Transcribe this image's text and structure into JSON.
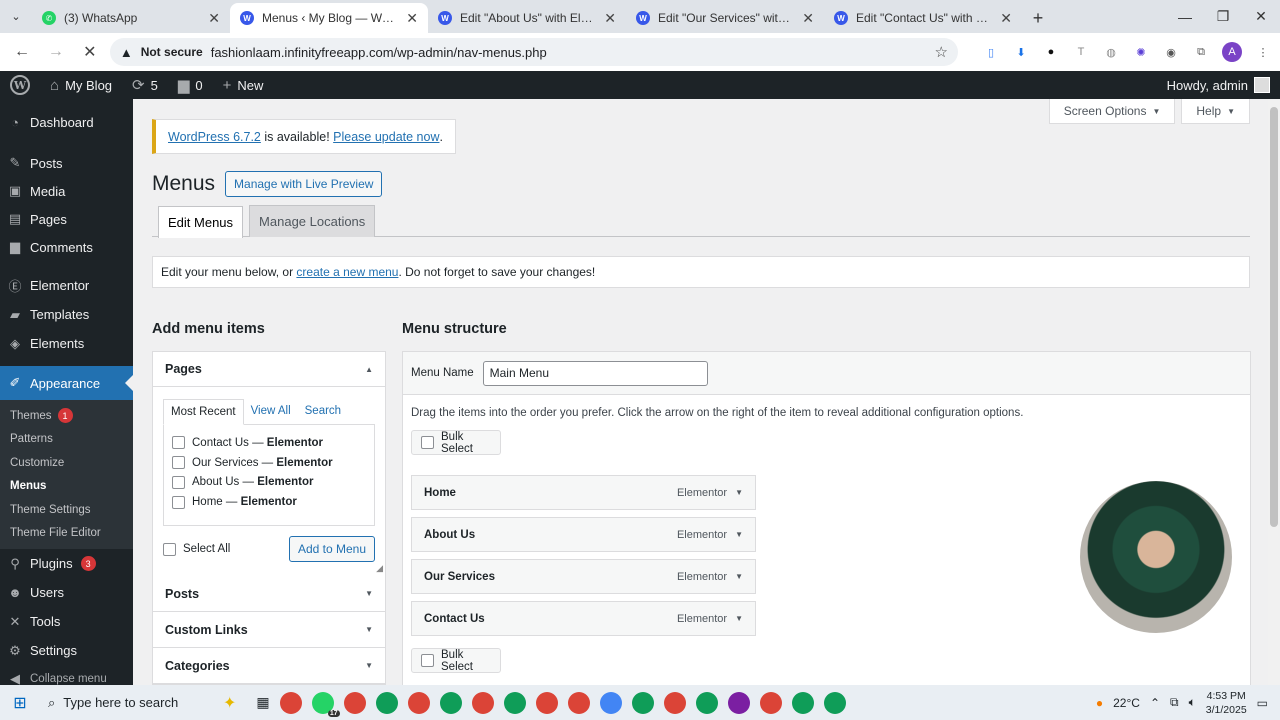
{
  "browser": {
    "tabs": [
      {
        "title": "(3) WhatsApp",
        "icon": "whatsapp-icon",
        "active": false
      },
      {
        "title": "Menus ‹ My Blog — WordPress",
        "icon": "wordpress-icon",
        "active": true
      },
      {
        "title": "Edit \"About Us\" with Elementor",
        "icon": "wordpress-icon",
        "active": false
      },
      {
        "title": "Edit \"Our Services\" with Elementor",
        "icon": "wordpress-icon",
        "active": false
      },
      {
        "title": "Edit \"Contact Us\" with Elementor",
        "icon": "wordpress-icon",
        "active": false
      }
    ],
    "security_label": "Not secure",
    "url": "fashionlaam.infinityfreeapp.com/wp-admin/nav-menus.php",
    "profile_initial": "A"
  },
  "adminbar": {
    "site_name": "My Blog",
    "updates_count": "5",
    "comments_count": "0",
    "new_label": "New",
    "howdy": "Howdy, admin"
  },
  "sidebar": {
    "items": [
      {
        "label": "Dashboard",
        "icon": "dashboard-icon"
      },
      {
        "label": "Posts",
        "icon": "pin-icon"
      },
      {
        "label": "Media",
        "icon": "media-icon"
      },
      {
        "label": "Pages",
        "icon": "page-icon"
      },
      {
        "label": "Comments",
        "icon": "comment-icon"
      },
      {
        "label": "Elementor",
        "icon": "elementor-icon"
      },
      {
        "label": "Templates",
        "icon": "folder-icon"
      },
      {
        "label": "Elements",
        "icon": "layers-icon"
      },
      {
        "label": "Appearance",
        "icon": "brush-icon"
      },
      {
        "label": "Plugins",
        "icon": "plugin-icon",
        "badge": "3"
      },
      {
        "label": "Users",
        "icon": "user-icon"
      },
      {
        "label": "Tools",
        "icon": "wrench-icon"
      },
      {
        "label": "Settings",
        "icon": "settings-icon"
      }
    ],
    "appearance_sub": [
      {
        "label": "Themes",
        "badge": "1"
      },
      {
        "label": "Patterns"
      },
      {
        "label": "Customize"
      },
      {
        "label": "Menus"
      },
      {
        "label": "Theme Settings"
      },
      {
        "label": "Theme File Editor"
      }
    ],
    "collapse_label": "Collapse menu"
  },
  "screen_options": {
    "screen_label": "Screen Options",
    "help_label": "Help"
  },
  "notice": {
    "link1": "WordPress 6.7.2",
    "text": " is available! ",
    "link2": "Please update now",
    "end": "."
  },
  "page": {
    "title": "Menus",
    "live_preview_btn": "Manage with Live Preview",
    "tabs": [
      "Edit Menus",
      "Manage Locations"
    ],
    "manage_text_pre": "Edit your menu below, or ",
    "manage_link": "create a new menu",
    "manage_text_post": ". Do not forget to save your changes!"
  },
  "add_items": {
    "heading": "Add menu items",
    "pages_title": "Pages",
    "sub_tabs": [
      "Most Recent",
      "View All",
      "Search"
    ],
    "pages": [
      {
        "title": "Contact Us",
        "suffix": "Elementor"
      },
      {
        "title": "Our Services",
        "suffix": "Elementor"
      },
      {
        "title": "About Us",
        "suffix": "Elementor"
      },
      {
        "title": "Home",
        "suffix": "Elementor"
      }
    ],
    "separator": " — ",
    "select_all": "Select All",
    "add_button": "Add to Menu",
    "other_sections": [
      "Posts",
      "Custom Links",
      "Categories"
    ]
  },
  "structure": {
    "heading": "Menu structure",
    "menu_name_label": "Menu Name",
    "menu_name_value": "Main Menu",
    "instructions": "Drag the items into the order you prefer. Click the arrow on the right of the item to reveal additional configuration options.",
    "bulk_select": "Bulk Select",
    "items": [
      {
        "title": "Home",
        "type": "Elementor"
      },
      {
        "title": "About Us",
        "type": "Elementor"
      },
      {
        "title": "Our Services",
        "type": "Elementor"
      },
      {
        "title": "Contact Us",
        "type": "Elementor"
      }
    ]
  },
  "taskbar": {
    "search_placeholder": "Type here to search",
    "whatsapp_badge": "17",
    "temperature": "22°C",
    "time": "4:53 PM",
    "date": "3/1/2025"
  },
  "colors": {
    "wp_blue": "#2271b1",
    "admin_dark": "#1d2327",
    "notice_yellow": "#dba617",
    "badge_red": "#d63638"
  }
}
